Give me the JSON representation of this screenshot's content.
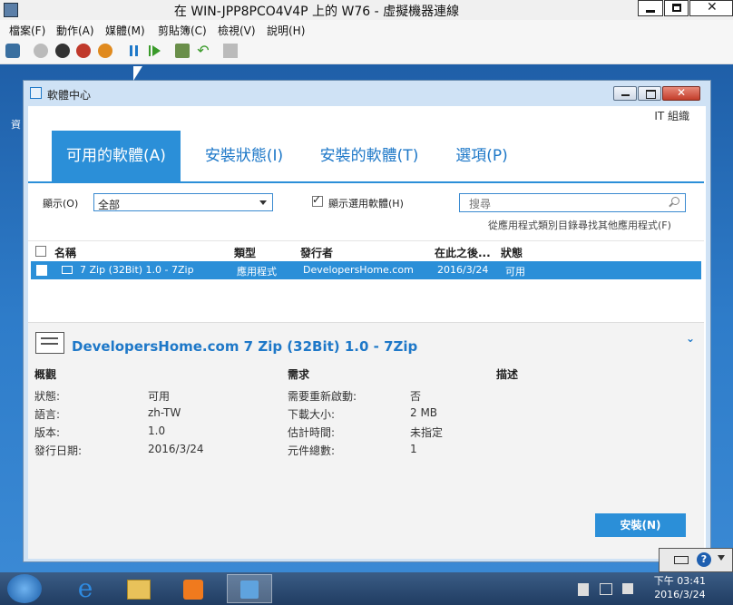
{
  "host": {
    "title": "在 WIN-JPP8PCO4V4P 上的 W76 - 虛擬機器連線",
    "menu": [
      "檔案(F)",
      "動作(A)",
      "媒體(M)",
      "剪貼簿(C)",
      "檢視(V)",
      "說明(H)"
    ]
  },
  "desktop": {
    "side_label": "資"
  },
  "window": {
    "title": "軟體中心",
    "org": "IT 組織",
    "tabs": [
      "可用的軟體(A)",
      "安裝狀態(I)",
      "安裝的軟體(T)",
      "選項(P)"
    ],
    "filter": {
      "show_label": "顯示(O)",
      "show_value": "全部",
      "optional_label": "顯示選用軟體(H)",
      "optional_checked": true,
      "search_placeholder": "搜尋",
      "catalog_link": "從應用程式類別目錄尋找其他應用程式(F)"
    },
    "columns": [
      "名稱",
      "類型",
      "發行者",
      "在此之後...",
      "狀態"
    ],
    "rows": [
      {
        "name": "7 Zip (32Bit) 1.0 - 7Zip",
        "type": "應用程式",
        "publisher": "DevelopersHome.com",
        "date": "2016/3/24",
        "status": "可用"
      }
    ],
    "details": {
      "title": "DevelopersHome.com 7 Zip (32Bit) 1.0 - 7Zip",
      "sections": [
        "概觀",
        "需求",
        "描述"
      ],
      "overview": [
        {
          "k": "狀態:",
          "v": "可用"
        },
        {
          "k": "語言:",
          "v": "zh-TW"
        },
        {
          "k": "版本:",
          "v": "1.0"
        },
        {
          "k": "發行日期:",
          "v": "2016/3/24"
        }
      ],
      "requirements": [
        {
          "k": "需要重新啟動:",
          "v": "否"
        },
        {
          "k": "下載大小:",
          "v": "2 MB"
        },
        {
          "k": "估計時間:",
          "v": "未指定"
        },
        {
          "k": "元件總數:",
          "v": "1"
        }
      ],
      "install_label": "安裝(N)"
    }
  },
  "taskbar": {
    "time": "下午 03:41",
    "date": "2016/3/24"
  },
  "colors": {
    "accent": "#2b8fd8",
    "link": "#1e78c8"
  }
}
